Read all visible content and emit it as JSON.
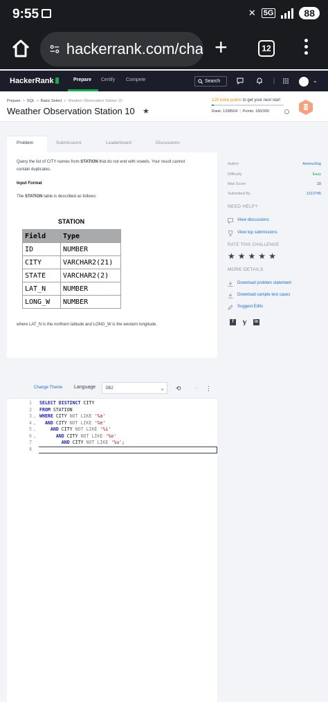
{
  "status_bar": {
    "time": "9:55",
    "network": "5G",
    "battery": "88"
  },
  "browser": {
    "url": "hackerrank.com/cha",
    "tab_count": "12"
  },
  "nav": {
    "logo": "HackerRank",
    "items": [
      "Prepare",
      "Certify",
      "Compete"
    ],
    "search_label": "Search"
  },
  "header": {
    "breadcrumbs": [
      "Prepare",
      "SQL",
      "Basic Select",
      "Weather Observation Station 10"
    ],
    "title": "Weather Observation Station 10",
    "points_highlight": "120 more points",
    "points_suffix": " to get your next star!",
    "points_progress": 0.03,
    "rank_label": "Rank: 1338504",
    "points_label": "Points: 180/300"
  },
  "tabs": [
    "Problem",
    "Submissions",
    "Leaderboard",
    "Discussions"
  ],
  "problem": {
    "desc_1": "Query the list of CITY names from ",
    "desc_bold": "STATION",
    "desc_2": " that do not end with vowels. Your result cannot",
    "desc_3": "contain duplicates.",
    "input_heading": "Input Format",
    "table_intro_1": "The ",
    "table_intro_bold": "STATION",
    "table_intro_2": " table is described as follows:",
    "table_title": "STATION",
    "table_headers": [
      "Field",
      "Type"
    ],
    "table_rows": [
      [
        "ID",
        "NUMBER"
      ],
      [
        "CITY",
        "VARCHAR2(21)"
      ],
      [
        "STATE",
        "VARCHAR2(2)"
      ],
      [
        "LAT_N",
        "NUMBER"
      ],
      [
        "LONG_W",
        "NUMBER"
      ]
    ],
    "footnote": "where LAT_N is the northern latitude and LONG_W is the western longitude."
  },
  "sidebar": {
    "author_label": "Author",
    "author": "AvmnuSng",
    "difficulty_label": "Difficulty",
    "difficulty": "Easy",
    "max_score_label": "Max Score",
    "max_score": "10",
    "submitted_label": "Submitted By",
    "submitted": "1313745",
    "need_help": "NEED HELP?",
    "view_discussions": "View discussions",
    "view_submissions": "View top submissions",
    "rate": "RATE THIS CHALLENGE",
    "more_details": "MORE DETAILS",
    "download_statement": "Download problem statement",
    "download_tests": "Download sample test cases",
    "suggest_edits": "Suggest Edits",
    "colors": {
      "easy": "#1ba94c",
      "link": "#1971d5"
    }
  },
  "editor": {
    "change_theme": "Change Theme",
    "language_label": "Language",
    "language": "DB2",
    "lines": [
      {
        "n": "1",
        "fold": "",
        "indent": "",
        "parts": [
          [
            "kw",
            "SELECT DISTINCT "
          ],
          [
            "t",
            "CITY"
          ]
        ]
      },
      {
        "n": "2",
        "fold": "",
        "indent": "",
        "parts": [
          [
            "kw",
            "FROM "
          ],
          [
            "t",
            "STATION"
          ]
        ]
      },
      {
        "n": "3",
        "fold": "⌄",
        "indent": "",
        "parts": [
          [
            "kw",
            "WHERE "
          ],
          [
            "t",
            "CITY "
          ],
          [
            "op",
            "NOT LIKE "
          ],
          [
            "str",
            "'%a'"
          ]
        ]
      },
      {
        "n": "4",
        "fold": "⌄",
        "indent": "  ",
        "parts": [
          [
            "kw",
            "AND "
          ],
          [
            "t",
            "CITY "
          ],
          [
            "op",
            "NOT LIKE "
          ],
          [
            "str",
            "'%e'"
          ]
        ]
      },
      {
        "n": "5",
        "fold": "⌄",
        "indent": "    ",
        "parts": [
          [
            "kw",
            "AND "
          ],
          [
            "t",
            "CITY "
          ],
          [
            "op",
            "NOT LIKE "
          ],
          [
            "str",
            "'%i'"
          ]
        ]
      },
      {
        "n": "6",
        "fold": "⌄",
        "indent": "      ",
        "parts": [
          [
            "kw",
            "AND "
          ],
          [
            "t",
            "CITY "
          ],
          [
            "op",
            "NOT LIKE "
          ],
          [
            "str",
            "'%o'"
          ]
        ]
      },
      {
        "n": "7",
        "fold": "",
        "indent": "        ",
        "parts": [
          [
            "kw",
            "AND "
          ],
          [
            "t",
            "CITY "
          ],
          [
            "op",
            "NOT LIKE "
          ],
          [
            "str",
            "'%u'"
          ],
          [
            "t",
            ";"
          ]
        ]
      },
      {
        "n": "8",
        "fold": "",
        "indent": "",
        "parts": []
      }
    ]
  }
}
